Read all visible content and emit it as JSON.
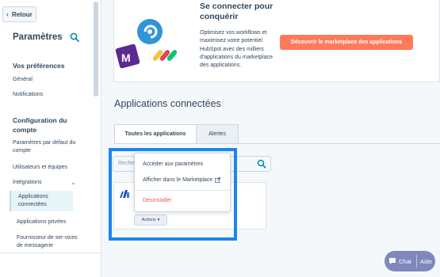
{
  "sidebar": {
    "back_label": "Retour",
    "title": "Paramètres",
    "sections": [
      {
        "title": "Vos préférences",
        "items": [
          "Général",
          "Notifications"
        ]
      },
      {
        "title": "Configuration du compte",
        "items": [
          "Paramètres par défaut du compte",
          "Utilisateurs et équipes",
          "Intégrations",
          "Applications connectées",
          "Applications privées",
          "Fournisseur de ser-vices de messagerie"
        ]
      }
    ]
  },
  "banner": {
    "title": "Se connecter pour conquérir",
    "text": "Optimisez vos workflows et maximisez votre potentiel HubSpot avec des milliers d'applications du marketplace des applications.",
    "cta_label": "Découvrir le marketplace des applications"
  },
  "main": {
    "heading": "Applications connectées",
    "tabs": [
      {
        "label": "Toutes les applications",
        "active": true
      },
      {
        "label": "Alertes",
        "active": false
      }
    ],
    "search_placeholder": "Reche",
    "actions_label": "Actions",
    "dropdown": {
      "items": [
        "Accéder aux paramètres",
        "Afficher dans le Marketplace",
        "Désinstaller"
      ]
    }
  },
  "chat_widget": {
    "chat_label": "Chat",
    "help_label": "Aide"
  },
  "colors": {
    "accent": "#ff7a59",
    "highlight": "#1b86ec",
    "link": "#0091ae",
    "danger": "#f2545b"
  }
}
